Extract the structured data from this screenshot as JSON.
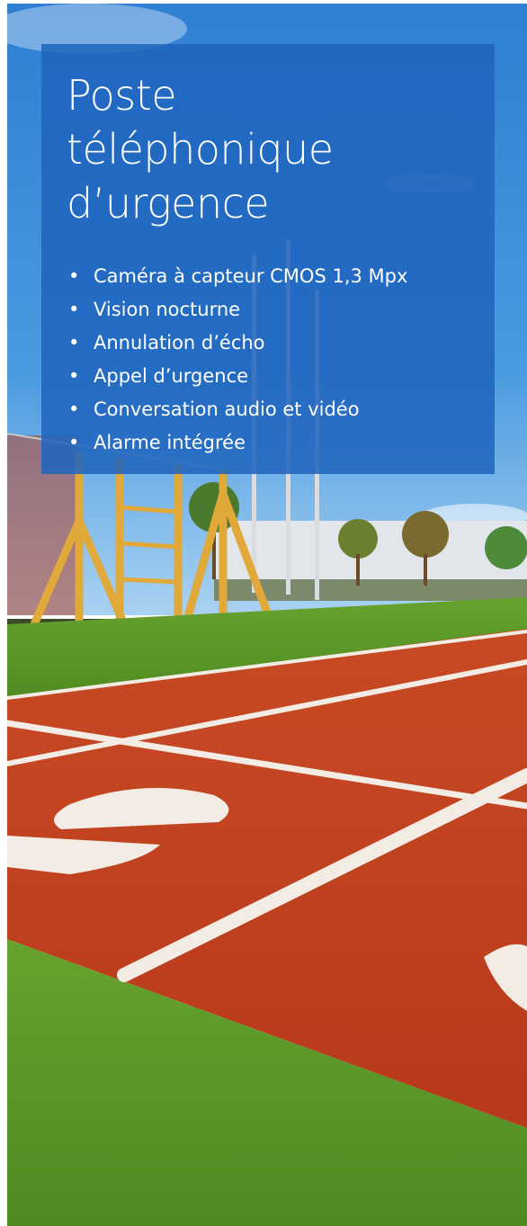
{
  "banner": {
    "title_lines": [
      "Poste",
      "téléphonique",
      "d’urgence"
    ],
    "features": [
      "Caméra à capteur CMOS 1,3 Mpx",
      "Vision nocturne",
      "Annulation d’écho",
      "Appel d’urgence",
      "Conversation audio et vidéo",
      "Alarme intégrée"
    ],
    "background_image": "running-track-photo",
    "colors": {
      "panel": "#1e64be",
      "sky": "#3a8ad8",
      "track": "#c9401f",
      "grass": "#5d9a2a",
      "lane_lines": "#f3ece4"
    }
  }
}
